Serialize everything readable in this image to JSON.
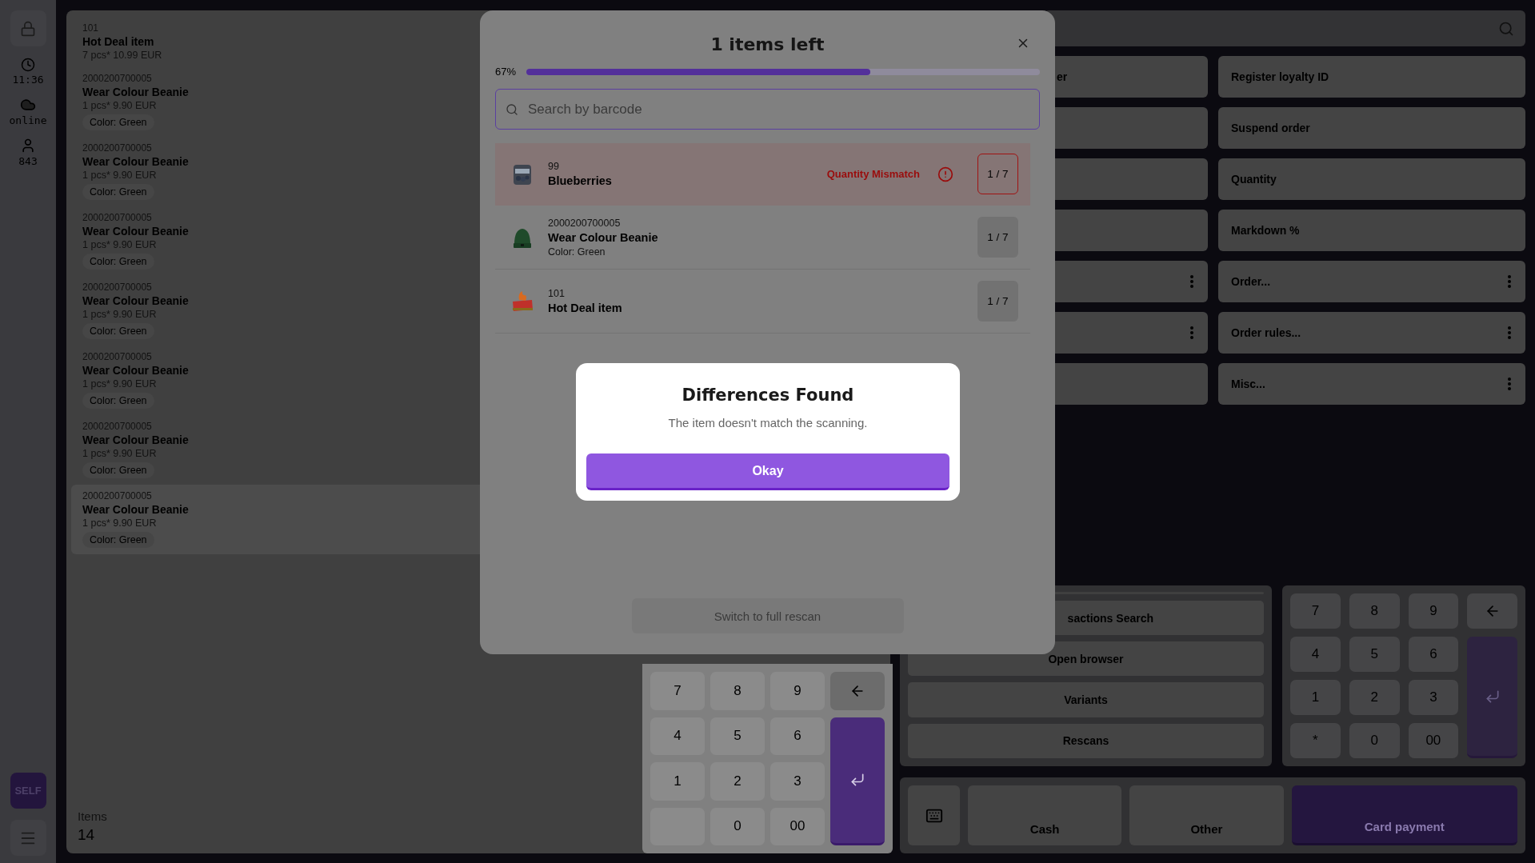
{
  "sidebar": {
    "time": "11:36",
    "status": "online",
    "user_count": "843",
    "self_button": "SELF"
  },
  "order_list": {
    "items": [
      {
        "code": "101",
        "name": "Hot Deal item",
        "price": "7 pcs* 10.99 EUR",
        "selected": false
      },
      {
        "code": "2000200700005",
        "name": "Wear Colour Beanie",
        "price": "1 pcs* 9.90 EUR",
        "variant": "Color: Green",
        "selected": false
      },
      {
        "code": "2000200700005",
        "name": "Wear Colour Beanie",
        "price": "1 pcs* 9.90 EUR",
        "variant": "Color: Green",
        "selected": false
      },
      {
        "code": "2000200700005",
        "name": "Wear Colour Beanie",
        "price": "1 pcs* 9.90 EUR",
        "variant": "Color: Green",
        "selected": false
      },
      {
        "code": "2000200700005",
        "name": "Wear Colour Beanie",
        "price": "1 pcs* 9.90 EUR",
        "variant": "Color: Green",
        "selected": false
      },
      {
        "code": "2000200700005",
        "name": "Wear Colour Beanie",
        "price": "1 pcs* 9.90 EUR",
        "variant": "Color: Green",
        "selected": false
      },
      {
        "code": "2000200700005",
        "name": "Wear Colour Beanie",
        "price": "1 pcs* 9.90 EUR",
        "variant": "Color: Green",
        "selected": false
      },
      {
        "code": "2000200700005",
        "name": "Wear Colour Beanie",
        "price": "1 pcs* 9.90 EUR",
        "variant": "Color: Green",
        "selected": true
      }
    ],
    "items_label": "Items",
    "items_count": "14"
  },
  "action_buttons": {
    "left": [
      {
        "label": "er",
        "menu": false
      },
      {
        "menu": false
      },
      {
        "menu": false
      },
      {
        "menu": false
      },
      {
        "menu": true
      },
      {
        "menu": true
      },
      {
        "menu": false
      }
    ],
    "right": [
      {
        "label": "Register loyalty ID",
        "menu": false
      },
      {
        "label": "Suspend order",
        "menu": false
      },
      {
        "label": "Quantity",
        "menu": false
      },
      {
        "label": "Markdown %",
        "menu": false
      },
      {
        "label": "Order...",
        "menu": true
      },
      {
        "label": "Order rules...",
        "menu": true
      },
      {
        "label": "Misc...",
        "menu": true
      }
    ]
  },
  "function_buttons": [
    {
      "label": "sactions Search",
      "kind": "cut"
    },
    {
      "label": "Open browser",
      "kind": "full"
    },
    {
      "label": "Variants",
      "kind": "full"
    },
    {
      "label": "Rescans",
      "kind": "full"
    }
  ],
  "numpad": {
    "keys": [
      {
        "kind": "digit",
        "label": "7"
      },
      {
        "kind": "digit",
        "label": "8"
      },
      {
        "kind": "digit",
        "label": "9"
      },
      {
        "kind": "digit",
        "label": "4"
      },
      {
        "kind": "digit",
        "label": "5"
      },
      {
        "kind": "digit",
        "label": "6"
      },
      {
        "kind": "digit",
        "label": "1"
      },
      {
        "kind": "digit",
        "label": "2"
      },
      {
        "kind": "digit",
        "label": "3"
      },
      {
        "kind": "digit",
        "label": "*"
      },
      {
        "kind": "digit",
        "label": "0"
      },
      {
        "kind": "digit",
        "label": "00"
      }
    ]
  },
  "payment_buttons": [
    {
      "label": "Cash",
      "kind": "secondary"
    },
    {
      "label": "Other",
      "kind": "secondary"
    },
    {
      "label": "Card payment",
      "kind": "primary"
    }
  ],
  "rescan_modal": {
    "title": "1 items left",
    "progress_label": "67%",
    "level": 0.67,
    "search": {
      "placeholder": "Search by barcode"
    },
    "rows": [
      {
        "code": "99",
        "name": "Blueberries",
        "status": "Quantity Mismatch",
        "mismatch": true,
        "count": "1 / 7",
        "kind": "picture"
      },
      {
        "code": "2000200700005",
        "name": "Wear Colour Beanie",
        "variant": "Color: Green",
        "mismatch": false,
        "count": "1 / 7",
        "kind": "picture"
      },
      {
        "code": "101",
        "name": "Hot Deal item",
        "mismatch": false,
        "count": "1 / 7",
        "kind": "picture"
      }
    ],
    "full_rescan_button": {
      "label": "Switch to full rescan",
      "disabled": true
    },
    "keypad": {
      "keys": [
        {
          "kind": "digit",
          "label": "7"
        },
        {
          "kind": "digit",
          "label": "8"
        },
        {
          "kind": "digit",
          "label": "9"
        },
        {
          "kind": "digit",
          "label": "4"
        },
        {
          "kind": "digit",
          "label": "5"
        },
        {
          "kind": "digit",
          "label": "6"
        },
        {
          "kind": "digit",
          "label": "1"
        },
        {
          "kind": "digit",
          "label": "2"
        },
        {
          "kind": "digit",
          "label": "3"
        },
        {
          "kind": "blank"
        },
        {
          "kind": "digit",
          "label": "0"
        },
        {
          "kind": "digit",
          "label": "00"
        }
      ]
    }
  },
  "dialog": {
    "title": "Differences Found",
    "message": "The item doesn't match the scanning.",
    "button": "Okay"
  }
}
